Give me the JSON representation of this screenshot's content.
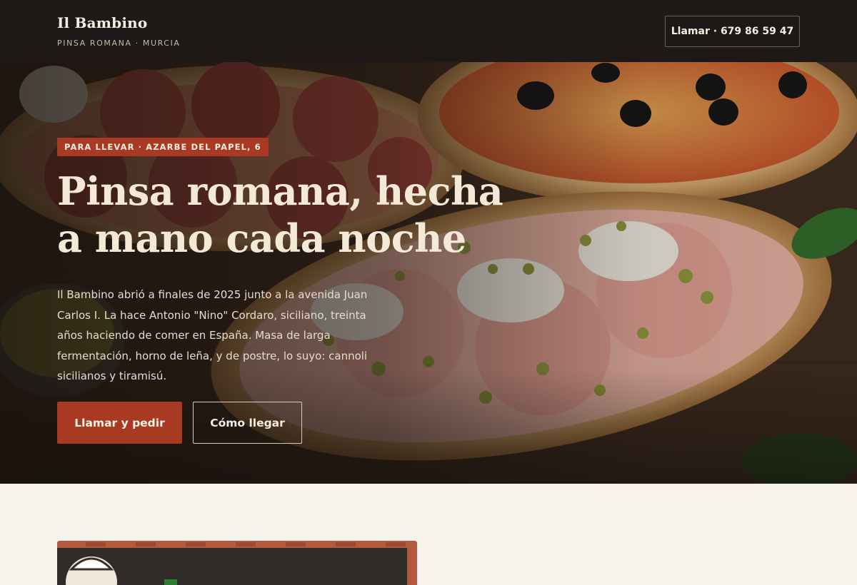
{
  "header": {
    "brand": "Il Bambino",
    "tagline": "PINSA ROMANA · MURCIA",
    "call_label": "Llamar · 679 86 59 47"
  },
  "hero": {
    "tag": "PARA LLEVAR · AZARBE DEL PAPEL, 6",
    "title_line1": "Pinsa romana, hecha",
    "title_line2": "a mano cada noche",
    "description": "Il Bambino abrió a finales de 2025 junto a la avenida Juan Carlos I. La hace Antonio \"Nino\" Cordaro, siciliano, treinta años haciendo de comer en España. Masa de larga fermentación, horno de leña, y de postre, lo suyo: cannoli sicilianos y tiramisú.",
    "primary_button": "Llamar y pedir",
    "secondary_button": "Cómo llegar",
    "image_icon": "pizza-photo"
  },
  "colors": {
    "header_bg": "#1e1916",
    "accent": "#a83a24",
    "page_bg": "#f8f3ea",
    "heading_text": "#f4e8d6"
  }
}
